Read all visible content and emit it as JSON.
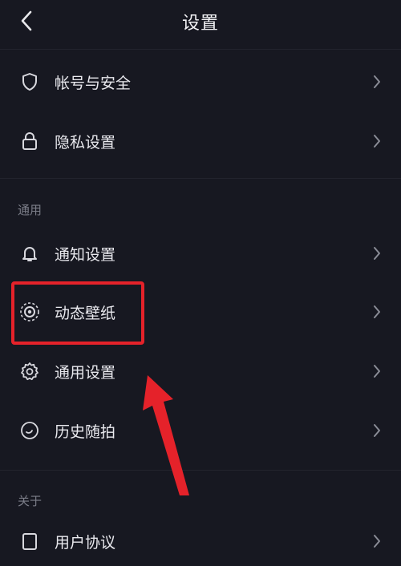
{
  "header": {
    "title": "设置",
    "back_icon": "chevron-left-icon"
  },
  "account_section": {
    "items": [
      {
        "label": "帐号与安全",
        "icon": "shield-icon"
      },
      {
        "label": "隐私设置",
        "icon": "lock-icon"
      }
    ]
  },
  "general_section": {
    "title": "通用",
    "items": [
      {
        "label": "通知设置",
        "icon": "bell-icon"
      },
      {
        "label": "动态壁纸",
        "icon": "live-wallpaper-icon"
      },
      {
        "label": "通用设置",
        "icon": "gear-icon"
      },
      {
        "label": "历史随拍",
        "icon": "history-icon"
      }
    ]
  },
  "about_section": {
    "title": "关于",
    "items": [
      {
        "label": "用户协议",
        "icon": "document-icon"
      }
    ]
  },
  "annotation": {
    "highlight_color": "#e5222a"
  }
}
